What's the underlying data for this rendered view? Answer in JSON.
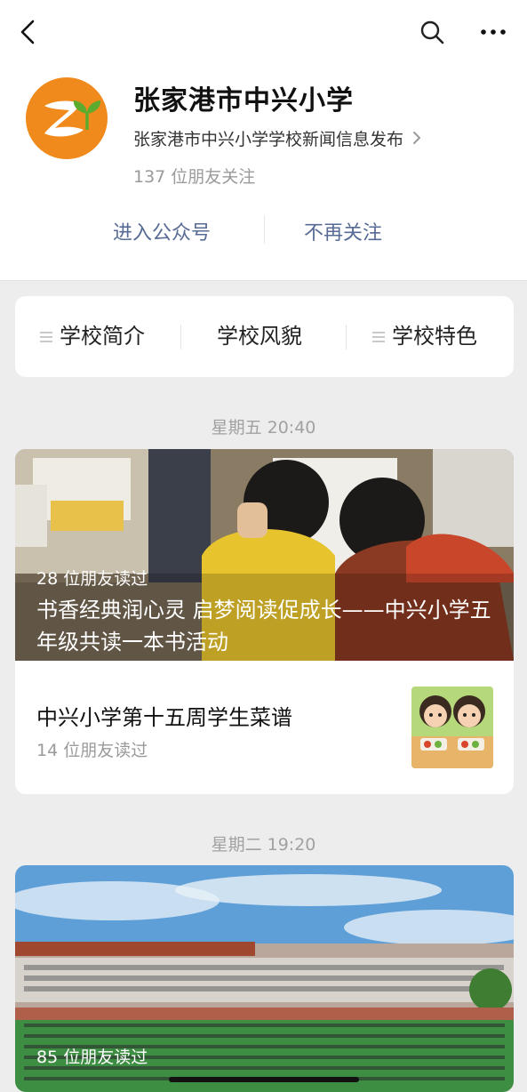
{
  "account": {
    "name": "张家港市中兴小学",
    "description": "张家港市中兴小学学校新闻信息发布",
    "followers": "137 位朋友关注"
  },
  "actions": {
    "enter": "进入公众号",
    "unfollow": "不再关注"
  },
  "menu": [
    {
      "label": "学校简介",
      "icon": "menu-lines-icon"
    },
    {
      "label": "学校风貌"
    },
    {
      "label": "学校特色",
      "icon": "menu-lines-icon"
    }
  ],
  "groups": [
    {
      "date": "星期五 20:40",
      "cover": {
        "read_count": "28 位朋友读过",
        "title": "书香经典润心灵 启梦阅读促成长——中兴小学五年级共读一本书活动"
      },
      "items": [
        {
          "title": "中兴小学第十五周学生菜谱",
          "read_count": "14 位朋友读过"
        }
      ]
    },
    {
      "date": "星期二 19:20",
      "cover": {
        "read_count": "85 位朋友读过"
      }
    }
  ],
  "colors": {
    "link": "#576b95",
    "logo_orange": "#f08a1c",
    "logo_green": "#5cab2e"
  }
}
